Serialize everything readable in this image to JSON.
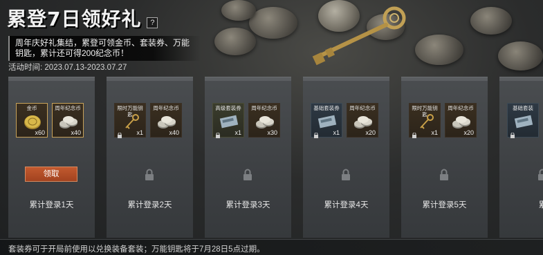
{
  "header": {
    "title": "累登7日领好礼",
    "help_label": "?"
  },
  "description": "周年庆好礼集结，累登可领金币、套装券、万能钥匙，累计还可得200纪念币！",
  "activity_time": {
    "label": "活动时间:",
    "value": "2023.07.13-2023.07.27"
  },
  "cards": [
    {
      "day_label": "累计登录1天",
      "status": "claimable",
      "button_label": "领取",
      "rewards": [
        {
          "name": "金币",
          "qty": "x60",
          "icon": "gold-coin-icon",
          "style": "sel"
        },
        {
          "name": "周年纪念币",
          "qty": "x40",
          "icon": "commemorative-coin-icon",
          "style": "sel"
        }
      ]
    },
    {
      "day_label": "累计登录2天",
      "status": "locked",
      "rewards": [
        {
          "name": "限时万能钥匙",
          "qty": "x1",
          "icon": "key-icon",
          "style": ""
        },
        {
          "name": "周年纪念币",
          "qty": "x40",
          "icon": "commemorative-coin-icon",
          "style": ""
        }
      ]
    },
    {
      "day_label": "累计登录3天",
      "status": "locked",
      "rewards": [
        {
          "name": "高级套装券",
          "qty": "x1",
          "icon": "outfit-ticket-icon",
          "style": "green"
        },
        {
          "name": "周年纪念币",
          "qty": "x30",
          "icon": "commemorative-coin-icon",
          "style": ""
        }
      ]
    },
    {
      "day_label": "累计登录4天",
      "status": "locked",
      "rewards": [
        {
          "name": "基础套装券",
          "qty": "x1",
          "icon": "outfit-ticket-icon",
          "style": "blue"
        },
        {
          "name": "周年纪念币",
          "qty": "x20",
          "icon": "commemorative-coin-icon",
          "style": ""
        }
      ]
    },
    {
      "day_label": "累计登录5天",
      "status": "locked",
      "rewards": [
        {
          "name": "限时万能钥匙",
          "qty": "x1",
          "icon": "key-icon",
          "style": ""
        },
        {
          "name": "周年纪念币",
          "qty": "x20",
          "icon": "commemorative-coin-icon",
          "style": ""
        }
      ]
    },
    {
      "day_label": "累",
      "status": "locked",
      "rewards": [
        {
          "name": "基础套装",
          "qty": "",
          "icon": "outfit-ticket-icon",
          "style": "blue"
        }
      ]
    }
  ],
  "footer": {
    "note": "套装券可于开局前使用以兑换装备套装；万能钥匙将于7月28日5点过期。"
  },
  "colors": {
    "claim_button": "#b24e27",
    "selected_border": "#c9a35a",
    "card_bg": "#404346"
  }
}
